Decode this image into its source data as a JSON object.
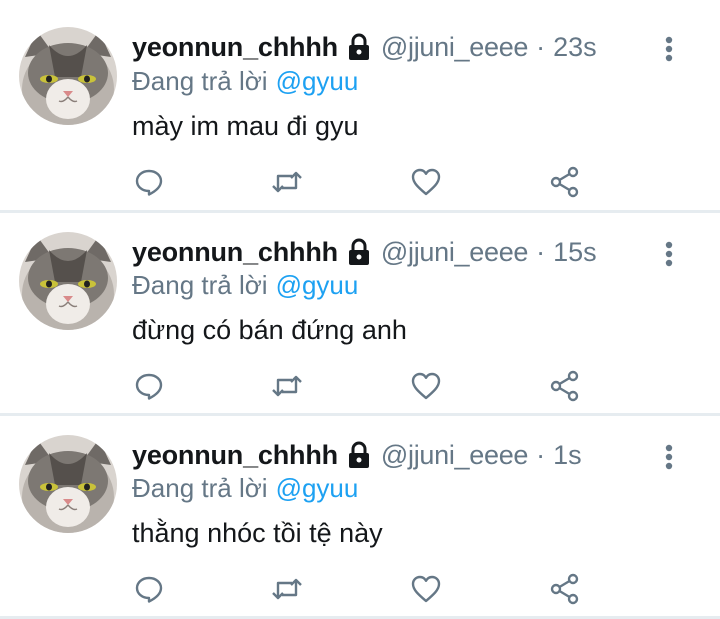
{
  "tweets": [
    {
      "name": "yeonnun_chhhh",
      "handle": "@jjuni_eeee",
      "separator": "·",
      "time": "23s",
      "reply_prefix": "Đang trả lời",
      "reply_to": "@gyuu",
      "text": "mày im mau đi gyu"
    },
    {
      "name": "yeonnun_chhhh",
      "handle": "@jjuni_eeee",
      "separator": "·",
      "time": "15s",
      "reply_prefix": "Đang trả lời",
      "reply_to": "@gyuu",
      "text": "đừng có bán đứng anh"
    },
    {
      "name": "yeonnun_chhhh",
      "handle": "@jjuni_eeee",
      "separator": "·",
      "time": "1s",
      "reply_prefix": "Đang trả lời",
      "reply_to": "@gyuu",
      "text": "thằng nhóc tồi tệ này"
    }
  ],
  "icons": {
    "lock": "lock-icon",
    "more": "more-vertical-icon",
    "reply": "reply-icon",
    "retweet": "retweet-icon",
    "like": "heart-icon",
    "share": "share-icon"
  },
  "colors": {
    "text": "#14171a",
    "secondary": "#657786",
    "mention": "#1da1f2",
    "divider": "#e6ecf0"
  }
}
